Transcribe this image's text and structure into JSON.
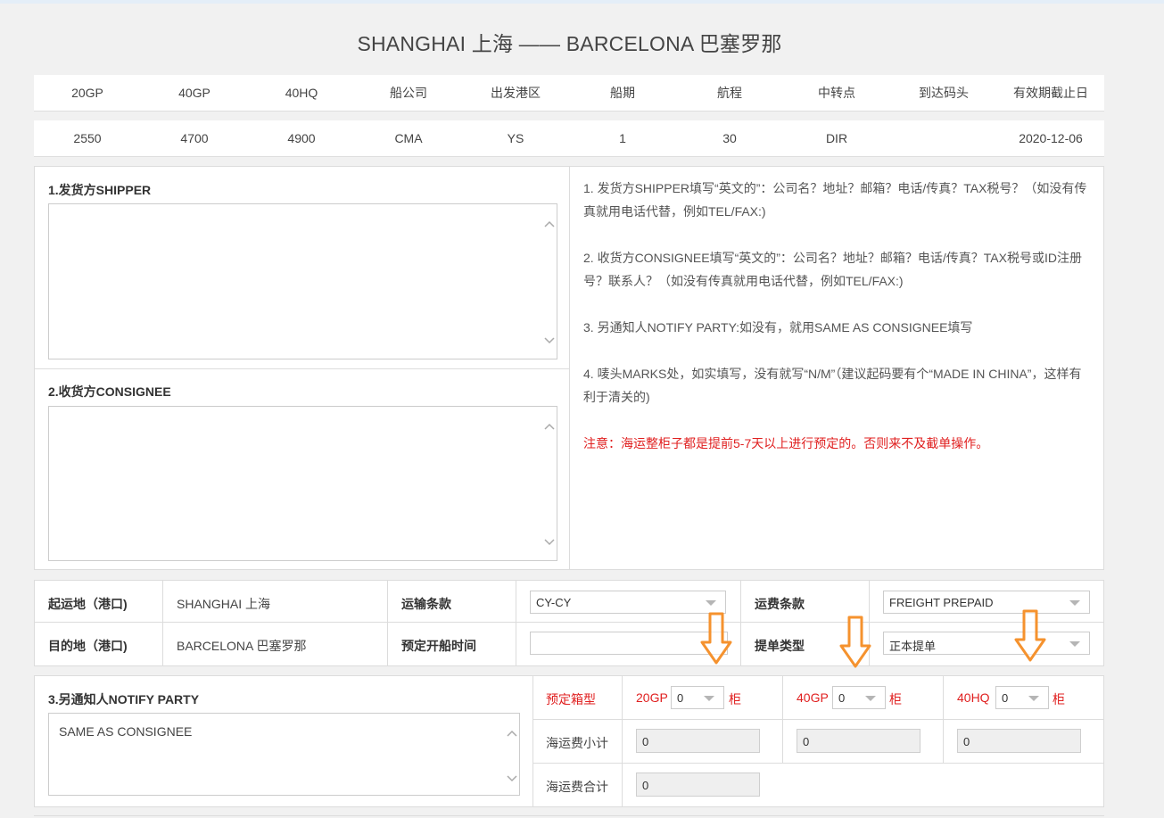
{
  "route_title": "SHANGHAI 上海 —— BARCELONA 巴塞罗那",
  "rate_table": {
    "headers": [
      "20GP",
      "40GP",
      "40HQ",
      "船公司",
      "出发港区",
      "船期",
      "航程",
      "中转点",
      "到达码头",
      "有效期截止日"
    ],
    "values": [
      "2550",
      "4700",
      "4900",
      "CMA",
      "YS",
      "1",
      "30",
      "DIR",
      "",
      "2020-12-06"
    ]
  },
  "shipper": {
    "label": "1.发货方SHIPPER",
    "value": ""
  },
  "consignee": {
    "label": "2.收货方CONSIGNEE",
    "value": ""
  },
  "notes": {
    "items": [
      "1. 发货方SHIPPER填写“英文的”：公司名？地址？邮箱？电话/传真？TAX税号？（如没有传真就用电话代替，例如TEL/FAX:)",
      "2. 收货方CONSIGNEE填写“英文的”：公司名？地址？邮箱？电话/传真？TAX税号或ID注册号？联系人？（如没有传真就用电话代替，例如TEL/FAX:)",
      "3. 另通知人NOTIFY PARTY:如没有，就用SAME AS CONSIGNEE填写",
      "4. 唛头MARKS处，如实填写，没有就写“N/M”（建议起码要有个“MADE IN CHINA”，这样有利于清关的)"
    ],
    "warning": "注意：海运整柜子都是提前5-7天以上进行预定的。否则来不及截单操作。"
  },
  "form": {
    "origin_label": "起运地（港口)",
    "origin_value": "SHANGHAI 上海",
    "destination_label": "目的地（港口)",
    "destination_value": "BARCELONA 巴塞罗那",
    "transport_terms_label": "运输条款",
    "transport_terms_value": "CY-CY",
    "departure_time_label": "预定开船时间",
    "departure_time_value": "",
    "freight_terms_label": "运费条款",
    "freight_terms_value": "FREIGHT PREPAID",
    "bl_type_label": "提单类型",
    "bl_type_value": "正本提单"
  },
  "notify": {
    "label": "3.另通知人NOTIFY PARTY",
    "value": "SAME AS CONSIGNEE"
  },
  "booking": {
    "container_type_label": "预定箱型",
    "unit": "柜",
    "containers": [
      {
        "type": "20GP",
        "qty": "0",
        "subtotal": "0"
      },
      {
        "type": "40GP",
        "qty": "0",
        "subtotal": "0"
      },
      {
        "type": "40HQ",
        "qty": "0",
        "subtotal": "0"
      }
    ],
    "subtotal_label": "海运费小计",
    "total_label": "海运费合计",
    "total_value": "0"
  },
  "colors": {
    "accent_red": "#e02020",
    "annotation_orange": "#f5922e",
    "background": "#f1f1f1"
  }
}
